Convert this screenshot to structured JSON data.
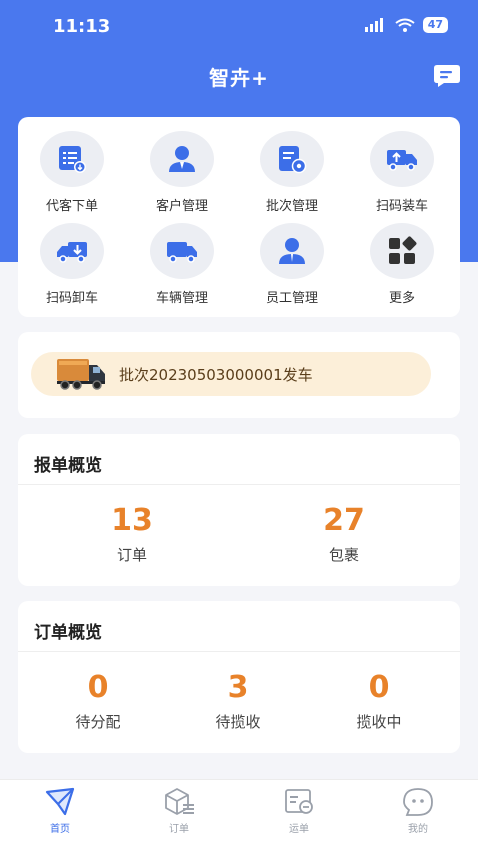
{
  "status_bar": {
    "time": "11:13",
    "battery": "47"
  },
  "header": {
    "title": "智卉+"
  },
  "quick_actions": [
    {
      "label": "代客下单",
      "icon": "order-list-icon"
    },
    {
      "label": "客户管理",
      "icon": "customer-icon"
    },
    {
      "label": "批次管理",
      "icon": "batch-settings-icon"
    },
    {
      "label": "扫码装车",
      "icon": "truck-load-icon"
    },
    {
      "label": "扫码卸车",
      "icon": "truck-unload-icon"
    },
    {
      "label": "车辆管理",
      "icon": "truck-icon"
    },
    {
      "label": "员工管理",
      "icon": "employee-icon"
    },
    {
      "label": "更多",
      "icon": "more-grid-icon"
    }
  ],
  "notice": {
    "text": "批次20230503000001发车"
  },
  "report_overview": {
    "title": "报单概览",
    "stats": [
      {
        "value": "13",
        "label": "订单"
      },
      {
        "value": "27",
        "label": "包裹"
      }
    ]
  },
  "order_overview": {
    "title": "订单概览",
    "stats": [
      {
        "value": "0",
        "label": "待分配"
      },
      {
        "value": "3",
        "label": "待揽收"
      },
      {
        "value": "0",
        "label": "揽收中"
      }
    ]
  },
  "tabbar": [
    {
      "label": "首页",
      "icon": "home-send-icon",
      "active": true
    },
    {
      "label": "订单",
      "icon": "order-box-icon",
      "active": false
    },
    {
      "label": "运单",
      "icon": "waybill-icon",
      "active": false
    },
    {
      "label": "我的",
      "icon": "profile-face-icon",
      "active": false
    }
  ],
  "colors": {
    "primary": "#4a78ee",
    "accent": "#e8822a",
    "notice_bg": "#fcefd9"
  }
}
